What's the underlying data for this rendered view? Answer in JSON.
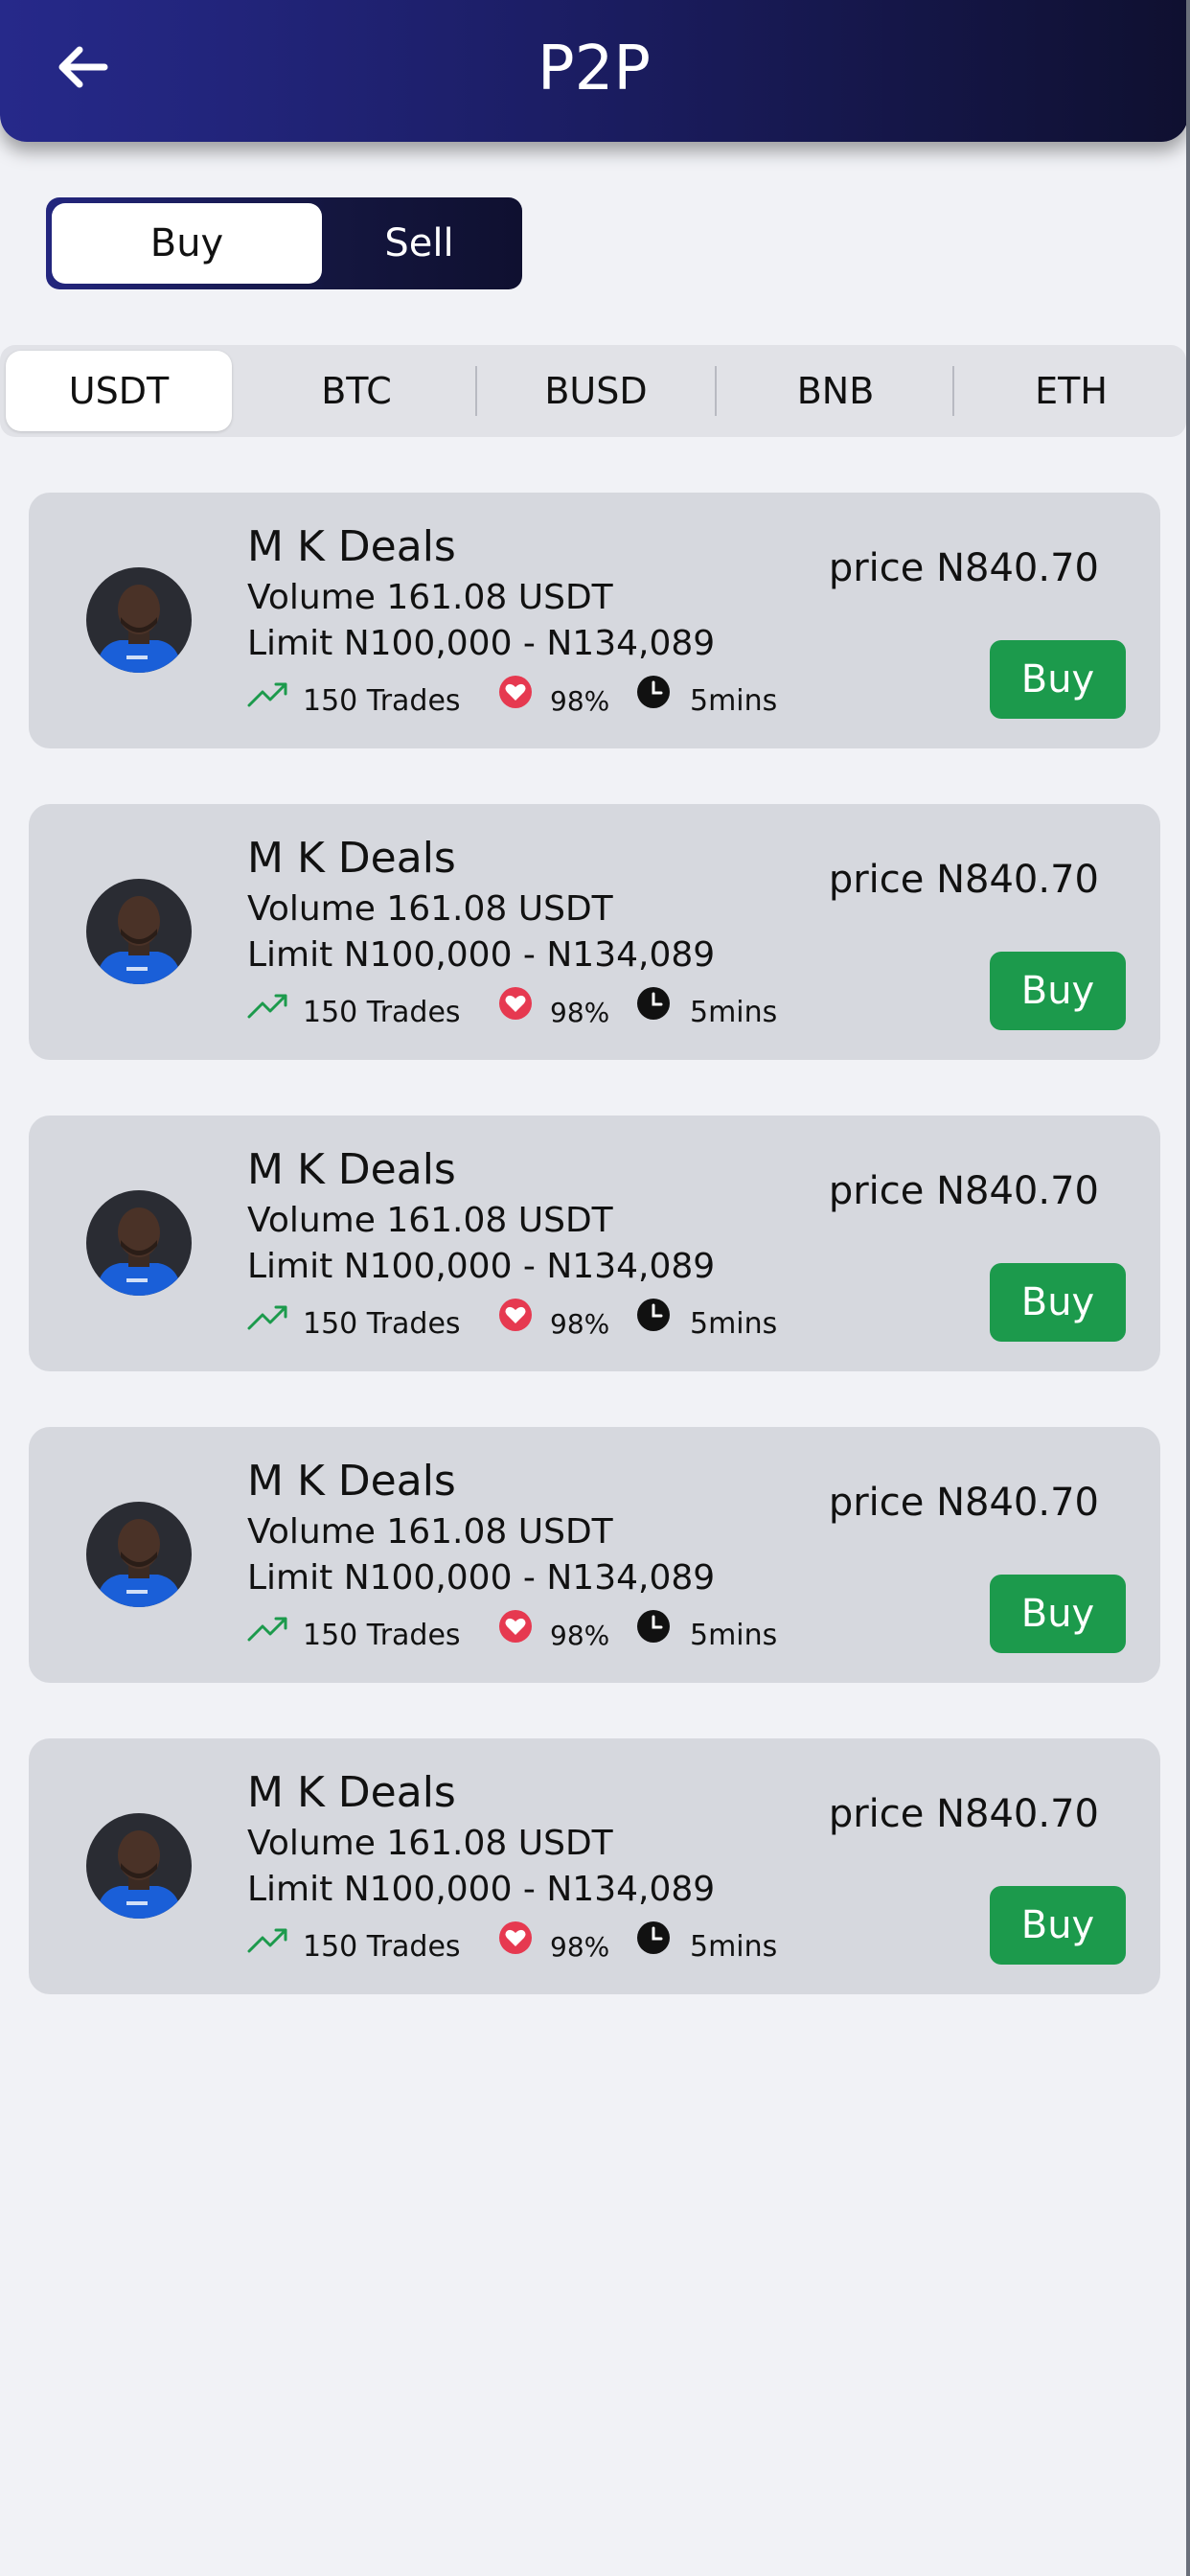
{
  "header": {
    "title": "P2P",
    "back_icon": "arrow-left-icon"
  },
  "mode_toggle": {
    "buy_label": "Buy",
    "sell_label": "Sell",
    "selected": "Buy"
  },
  "coin_tabs": {
    "selected": "USDT",
    "items": [
      {
        "label": "USDT"
      },
      {
        "label": "BTC"
      },
      {
        "label": "BUSD"
      },
      {
        "label": "BNB"
      },
      {
        "label": "ETH"
      }
    ]
  },
  "colors": {
    "header_gradient_start": "#26298a",
    "header_gradient_end": "#0f1030",
    "buy_button": "#1c9a4c",
    "card_bg": "#d6d8de",
    "trend_icon": "#1c9a4c",
    "heart_icon": "#e63950"
  },
  "offers": [
    {
      "merchant": "M K Deals",
      "volume": "Volume 161.08 USDT",
      "limit": "Limit N100,000 - N134,089",
      "trades": "150 Trades",
      "completion": "98%",
      "time": "5mins",
      "price": "price N840.70",
      "button": "Buy"
    },
    {
      "merchant": "M K Deals",
      "volume": "Volume 161.08 USDT",
      "limit": "Limit N100,000 - N134,089",
      "trades": "150 Trades",
      "completion": "98%",
      "time": "5mins",
      "price": "price N840.70",
      "button": "Buy"
    },
    {
      "merchant": "M K Deals",
      "volume": "Volume 161.08 USDT",
      "limit": "Limit N100,000 - N134,089",
      "trades": "150 Trades",
      "completion": "98%",
      "time": "5mins",
      "price": "price N840.70",
      "button": "Buy"
    },
    {
      "merchant": "M K Deals",
      "volume": "Volume 161.08 USDT",
      "limit": "Limit N100,000 - N134,089",
      "trades": "150 Trades",
      "completion": "98%",
      "time": "5mins",
      "price": "price N840.70",
      "button": "Buy"
    },
    {
      "merchant": "M K Deals",
      "volume": "Volume 161.08 USDT",
      "limit": "Limit N100,000 - N134,089",
      "trades": "150 Trades",
      "completion": "98%",
      "time": "5mins",
      "price": "price N840.70",
      "button": "Buy"
    }
  ]
}
